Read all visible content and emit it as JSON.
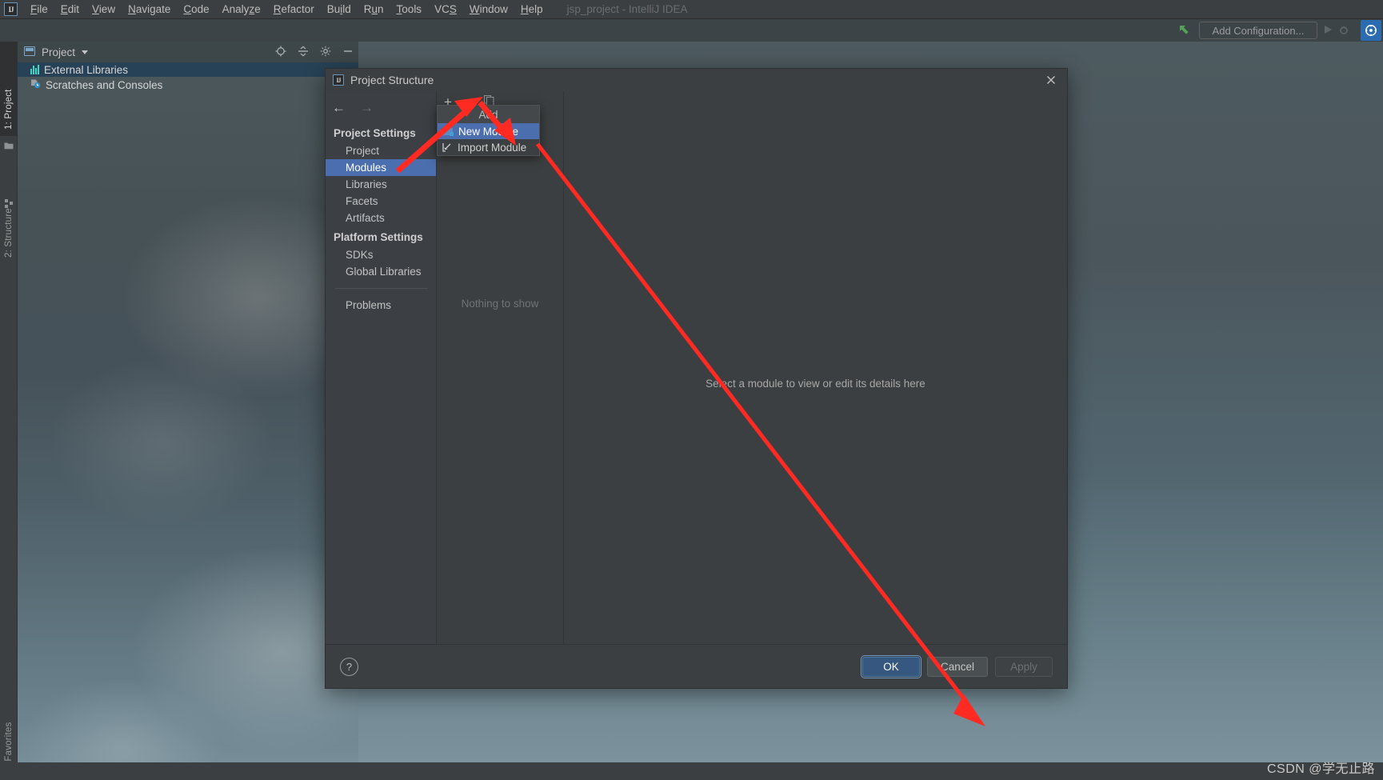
{
  "app": {
    "logo_text": "IJ",
    "window_title": "jsp_project - IntelliJ IDEA"
  },
  "menubar": {
    "items": [
      {
        "label": "File",
        "mnemonic": "F"
      },
      {
        "label": "Edit",
        "mnemonic": "E"
      },
      {
        "label": "View",
        "mnemonic": "V"
      },
      {
        "label": "Navigate",
        "mnemonic": "N"
      },
      {
        "label": "Code",
        "mnemonic": "C"
      },
      {
        "label": "Analyze",
        "mnemonic": "z"
      },
      {
        "label": "Refactor",
        "mnemonic": "R"
      },
      {
        "label": "Build",
        "mnemonic": "i"
      },
      {
        "label": "Run",
        "mnemonic": "u"
      },
      {
        "label": "Tools",
        "mnemonic": "T"
      },
      {
        "label": "VCS",
        "mnemonic": "S"
      },
      {
        "label": "Window",
        "mnemonic": "W"
      },
      {
        "label": "Help",
        "mnemonic": "H"
      }
    ]
  },
  "toolbar": {
    "add_configuration_label": "Add Configuration...",
    "green_arrow_icon": "green-up-left-arrow-icon",
    "run_icon": "run-icon",
    "plugin_icon": "plugin-badge-icon"
  },
  "left_strip": {
    "buttons": [
      {
        "label": "1: Project",
        "icon": "project-folder-icon",
        "selected": true
      },
      {
        "label": "2: Structure",
        "icon": "structure-icon",
        "selected": false
      },
      {
        "label": "2: Favorites",
        "icon": "favorites-icon",
        "selected": false
      }
    ]
  },
  "project_panel": {
    "title": "Project",
    "window_icon": "project-window-icon",
    "caret_icon": "chevron-down-icon",
    "toolbar_icons": [
      "locate-target-icon",
      "collapse-all-icon",
      "settings-gear-icon",
      "hide-minus-icon"
    ],
    "tree": [
      {
        "label": "External Libraries",
        "icon": "libraries-bars-icon",
        "selected": true
      },
      {
        "label": "Scratches and Consoles",
        "icon": "scratches-clock-icon",
        "selected": false
      }
    ]
  },
  "dialog": {
    "title": "Project Structure",
    "logo_text": "IJ",
    "close_icon": "close-icon",
    "nav": {
      "back_icon": "arrow-left-icon",
      "forward_icon": "arrow-right-icon"
    },
    "sidebar": {
      "project_settings_label": "Project Settings",
      "project_settings_items": [
        "Project",
        "Modules",
        "Libraries",
        "Facets",
        "Artifacts"
      ],
      "selected_item": "Modules",
      "platform_settings_label": "Platform Settings",
      "platform_settings_items": [
        "SDKs",
        "Global Libraries"
      ],
      "problems_label": "Problems"
    },
    "middle_panel": {
      "toolbar": {
        "add_icon": "plus-icon",
        "remove_icon": "minus-icon",
        "copy_icon": "copy-icon"
      },
      "empty_text": "Nothing to show"
    },
    "right_panel": {
      "empty_text": "Select a module to view or edit its details here"
    },
    "context_menu": {
      "header": "Add",
      "items": [
        {
          "label": "New Module",
          "icon": "new-module-folder-icon",
          "selected": true
        },
        {
          "label": "Import Module",
          "icon": "import-module-icon",
          "selected": false
        }
      ]
    },
    "footer": {
      "help_label": "?",
      "ok_label": "OK",
      "cancel_label": "Cancel",
      "apply_label": "Apply"
    }
  },
  "watermark": {
    "text": "CSDN @学无止路"
  },
  "colors": {
    "accent_blue": "#4b6eaf",
    "primary_button": "#365880",
    "annotation_red": "#ff2a22",
    "teal": "#41d6c3"
  }
}
